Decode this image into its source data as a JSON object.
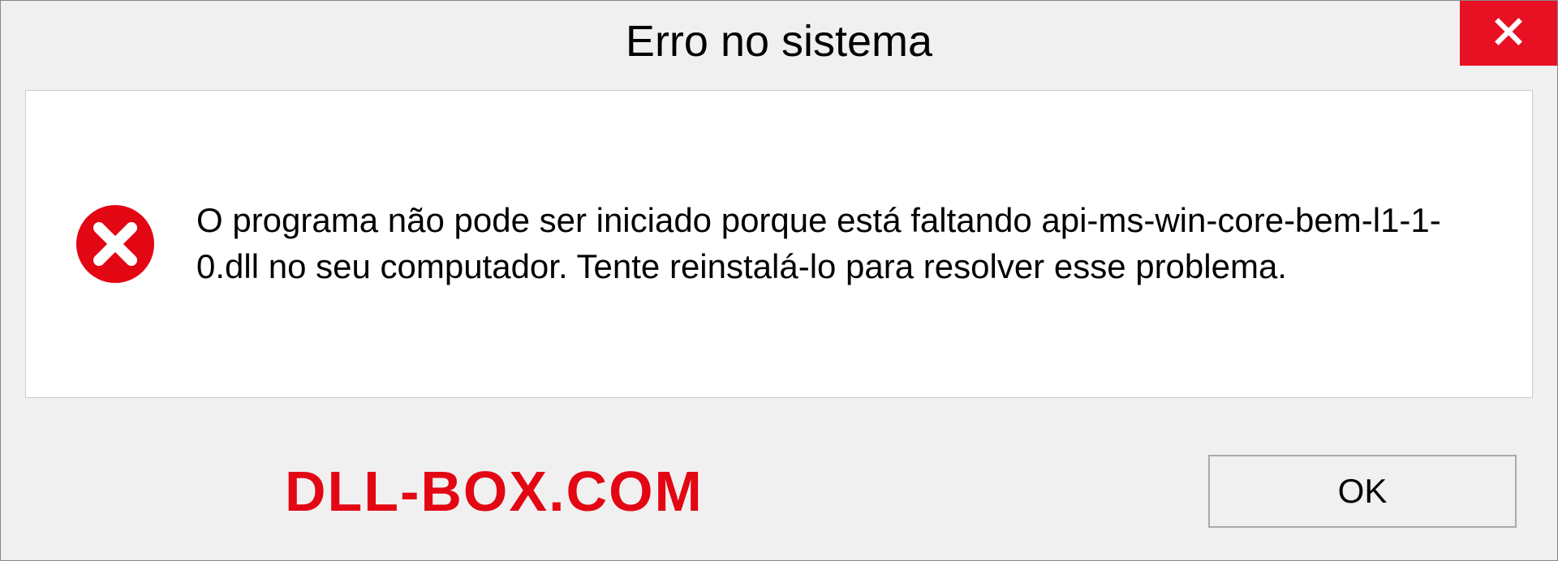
{
  "dialog": {
    "title": "Erro no sistema",
    "message": "O programa não pode ser iniciado porque está faltando api-ms-win-core-bem-l1-1-0.dll no seu computador. Tente reinstalá-lo para resolver esse problema.",
    "ok_label": "OK"
  },
  "watermark": "DLL-BOX.COM"
}
